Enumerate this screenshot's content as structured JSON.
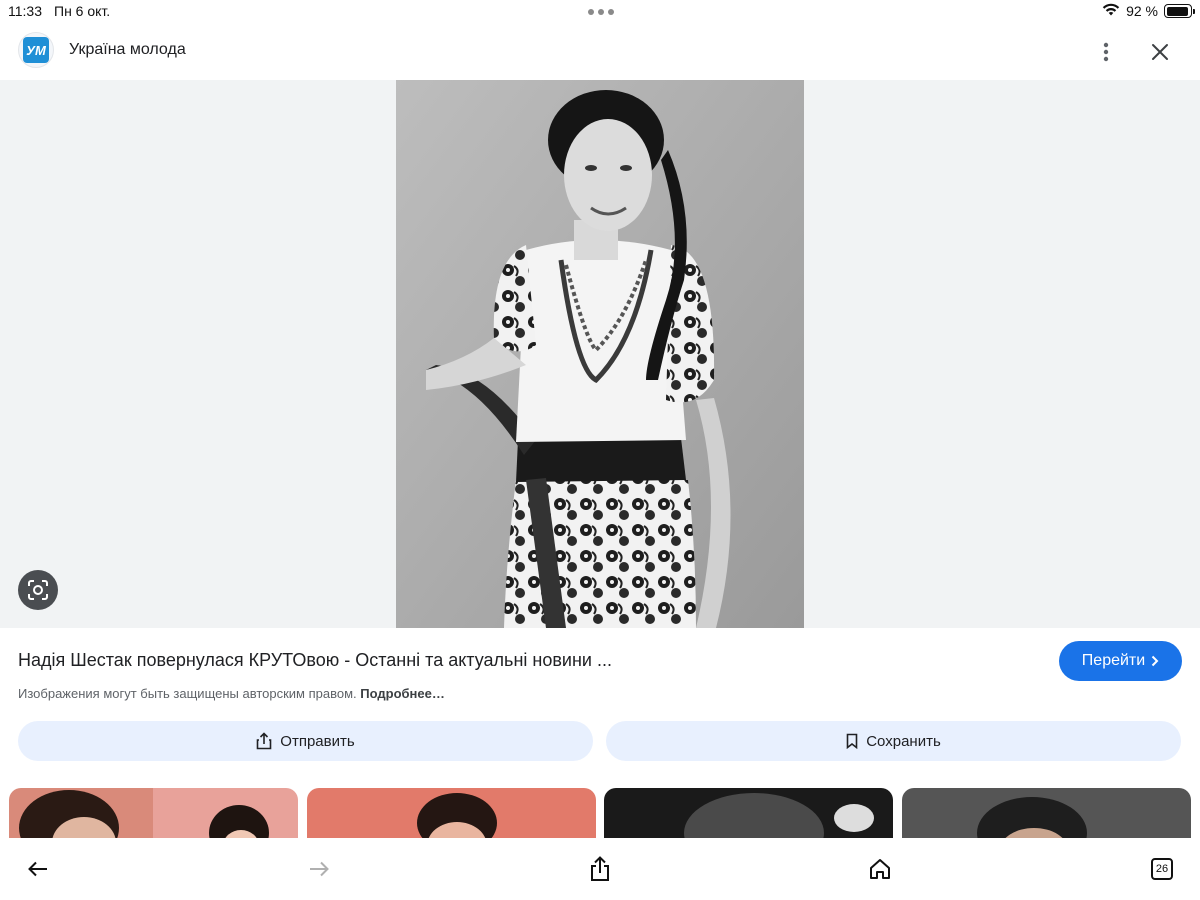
{
  "status_bar": {
    "time": "11:33",
    "date": "Пн 6 окт.",
    "battery_percent": "92 %",
    "battery_level": 0.92
  },
  "header": {
    "logo_text": "УМ",
    "site_name": "Україна молода"
  },
  "result": {
    "title": "Надія Шестак повернулася КРУТОвою - Останні та актуальні новини ...",
    "visit_label": "Перейти",
    "copyright_text": "Изображения могут быть защищены авторским правом.",
    "copyright_link": "Подробнее…"
  },
  "actions": {
    "share_label": "Отправить",
    "save_label": "Сохранить"
  },
  "toolbar": {
    "tabs_count": "26"
  },
  "colors": {
    "accent": "#1a73e8",
    "action_bg": "#e8f0fe",
    "viewer_bg": "#f1f3f4"
  },
  "icons": [
    "wifi-icon",
    "battery-icon",
    "more-vert-icon",
    "close-icon",
    "lens-icon",
    "chevron-right-icon",
    "share-icon",
    "bookmark-icon",
    "back-arrow-icon",
    "forward-arrow-icon",
    "home-icon",
    "tabs-icon"
  ]
}
